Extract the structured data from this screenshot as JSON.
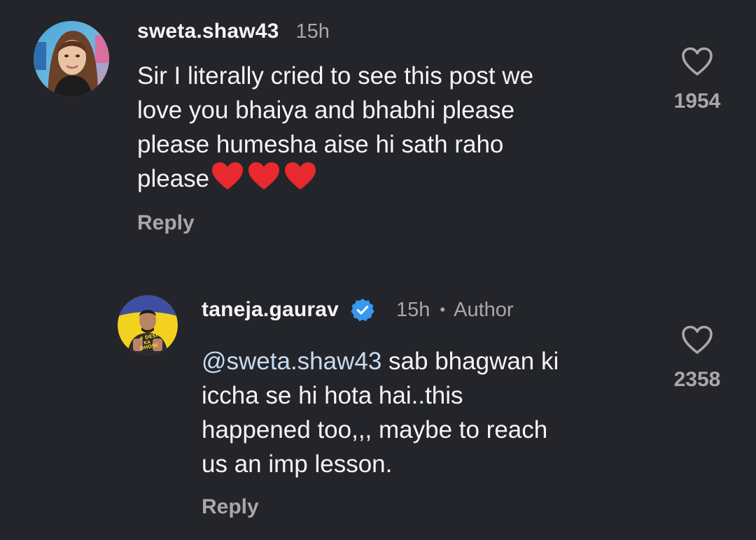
{
  "comments": [
    {
      "username": "sweta.shaw43",
      "time": "15h",
      "lines": [
        "Sir I literally cried to see this post we",
        "love you bhaiya and bhabhi please",
        "please humesha aise hi sath raho",
        "please"
      ],
      "emoji": "heart-emoji",
      "reply_label": "Reply",
      "like_count": "1954",
      "like_icon": "heart-outline-icon"
    },
    {
      "username": "taneja.gaurav",
      "verified_icon": "verified-badge-icon",
      "time": "15h",
      "separator": "•",
      "author_tag": "Author",
      "mention": "@sweta.shaw43",
      "text_first": " sab bhagwan ki",
      "lines": [
        "iccha se hi hota hai..this",
        "happened too,,, maybe to reach",
        "us an imp lesson."
      ],
      "reply_label": "Reply",
      "like_count": "2358",
      "like_icon": "heart-outline-icon",
      "avatar_text": [
        "# DESH",
        "KA",
        "DHONI"
      ]
    }
  ],
  "colors": {
    "background": "#23252a",
    "text": "#f5f5f5",
    "muted": "#a8a8a8",
    "mention": "#c7dcf3",
    "verified": "#3897f0",
    "heart_emoji": "#e8292f"
  }
}
